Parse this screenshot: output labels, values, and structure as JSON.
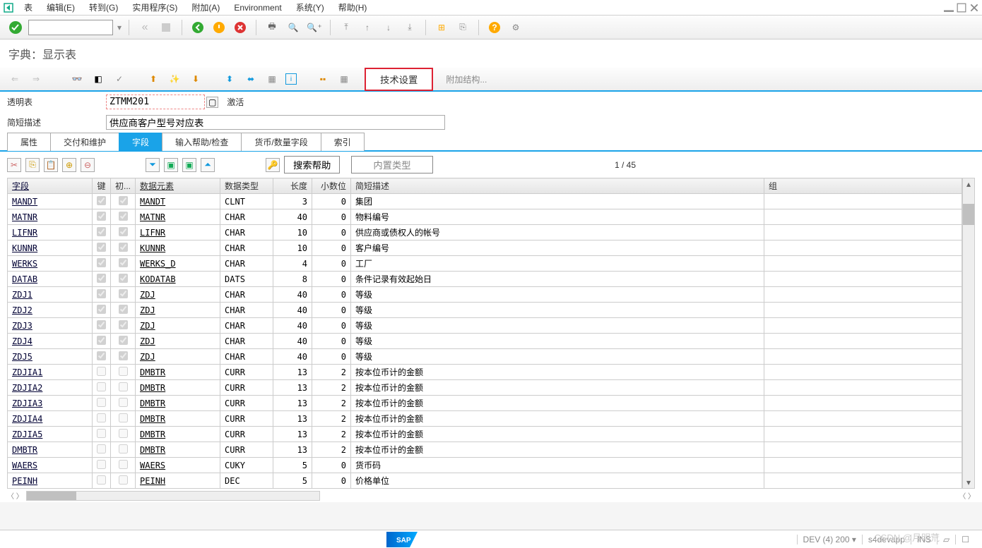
{
  "menu": {
    "table": "表",
    "edit": "编辑(E)",
    "goto": "转到(G)",
    "util": "实用程序(S)",
    "add": "附加(A)",
    "env": "Environment",
    "sys": "系统(Y)",
    "help": "帮助(H)"
  },
  "title": "字典：显示表",
  "toolbar2": {
    "tech": "技术设置",
    "addstruct": "附加结构..."
  },
  "form": {
    "lbl1": "透明表",
    "tablename": "ZTMM201",
    "status": "激活",
    "lbl2": "简短描述",
    "desc": "供应商客户型号对应表"
  },
  "tabs": [
    "属性",
    "交付和维护",
    "字段",
    "输入帮助/检查",
    "货币/数量字段",
    "索引"
  ],
  "activeTab": 2,
  "sub": {
    "search": "搜索帮助",
    "builtin": "内置类型",
    "count": "1  /  45"
  },
  "cols": {
    "field": "字段",
    "key": "键",
    "init": "初...",
    "de": "数据元素",
    "dtype": "数据类型",
    "len": "长度",
    "dec": "小数位",
    "desc": "简短描述",
    "group": "组"
  },
  "rows": [
    {
      "f": "MANDT",
      "k": true,
      "i": true,
      "de": "MANDT",
      "dt": "CLNT",
      "l": 3,
      "d": 0,
      "s": "集团"
    },
    {
      "f": "MATNR",
      "k": true,
      "i": true,
      "de": "MATNR",
      "dt": "CHAR",
      "l": 40,
      "d": 0,
      "s": "物料编号"
    },
    {
      "f": "LIFNR",
      "k": true,
      "i": true,
      "de": "LIFNR",
      "dt": "CHAR",
      "l": 10,
      "d": 0,
      "s": "供应商或债权人的帐号"
    },
    {
      "f": "KUNNR",
      "k": true,
      "i": true,
      "de": "KUNNR",
      "dt": "CHAR",
      "l": 10,
      "d": 0,
      "s": "客户编号"
    },
    {
      "f": "WERKS",
      "k": true,
      "i": true,
      "de": "WERKS_D",
      "dt": "CHAR",
      "l": 4,
      "d": 0,
      "s": "工厂"
    },
    {
      "f": "DATAB",
      "k": true,
      "i": true,
      "de": "KODATAB",
      "dt": "DATS",
      "l": 8,
      "d": 0,
      "s": "条件记录有效起始日"
    },
    {
      "f": "ZDJ1",
      "k": true,
      "i": true,
      "de": "ZDJ",
      "dt": "CHAR",
      "l": 40,
      "d": 0,
      "s": "等级"
    },
    {
      "f": "ZDJ2",
      "k": true,
      "i": true,
      "de": "ZDJ",
      "dt": "CHAR",
      "l": 40,
      "d": 0,
      "s": "等级"
    },
    {
      "f": "ZDJ3",
      "k": true,
      "i": true,
      "de": "ZDJ",
      "dt": "CHAR",
      "l": 40,
      "d": 0,
      "s": "等级"
    },
    {
      "f": "ZDJ4",
      "k": true,
      "i": true,
      "de": "ZDJ",
      "dt": "CHAR",
      "l": 40,
      "d": 0,
      "s": "等级"
    },
    {
      "f": "ZDJ5",
      "k": true,
      "i": true,
      "de": "ZDJ",
      "dt": "CHAR",
      "l": 40,
      "d": 0,
      "s": "等级"
    },
    {
      "f": "ZDJIA1",
      "k": false,
      "i": false,
      "de": "DMBTR",
      "dt": "CURR",
      "l": 13,
      "d": 2,
      "s": "按本位币计的金额"
    },
    {
      "f": "ZDJIA2",
      "k": false,
      "i": false,
      "de": "DMBTR",
      "dt": "CURR",
      "l": 13,
      "d": 2,
      "s": "按本位币计的金额"
    },
    {
      "f": "ZDJIA3",
      "k": false,
      "i": false,
      "de": "DMBTR",
      "dt": "CURR",
      "l": 13,
      "d": 2,
      "s": "按本位币计的金额"
    },
    {
      "f": "ZDJIA4",
      "k": false,
      "i": false,
      "de": "DMBTR",
      "dt": "CURR",
      "l": 13,
      "d": 2,
      "s": "按本位币计的金额"
    },
    {
      "f": "ZDJIA5",
      "k": false,
      "i": false,
      "de": "DMBTR",
      "dt": "CURR",
      "l": 13,
      "d": 2,
      "s": "按本位币计的金额"
    },
    {
      "f": "DMBTR",
      "k": false,
      "i": false,
      "de": "DMBTR",
      "dt": "CURR",
      "l": 13,
      "d": 2,
      "s": "按本位币计的金额"
    },
    {
      "f": "WAERS",
      "k": false,
      "i": false,
      "de": "WAERS",
      "dt": "CUKY",
      "l": 5,
      "d": 0,
      "s": "货币码"
    },
    {
      "f": "PEINH",
      "k": false,
      "i": false,
      "de": "PEINH",
      "dt": "DEC",
      "l": 5,
      "d": 0,
      "s": "价格单位"
    }
  ],
  "status": {
    "sap": "SAP",
    "sys": "DEV (4) 200",
    "srv": "s4devapp",
    "mode": "INS"
  },
  "watermark": "CSDN @月明荒"
}
